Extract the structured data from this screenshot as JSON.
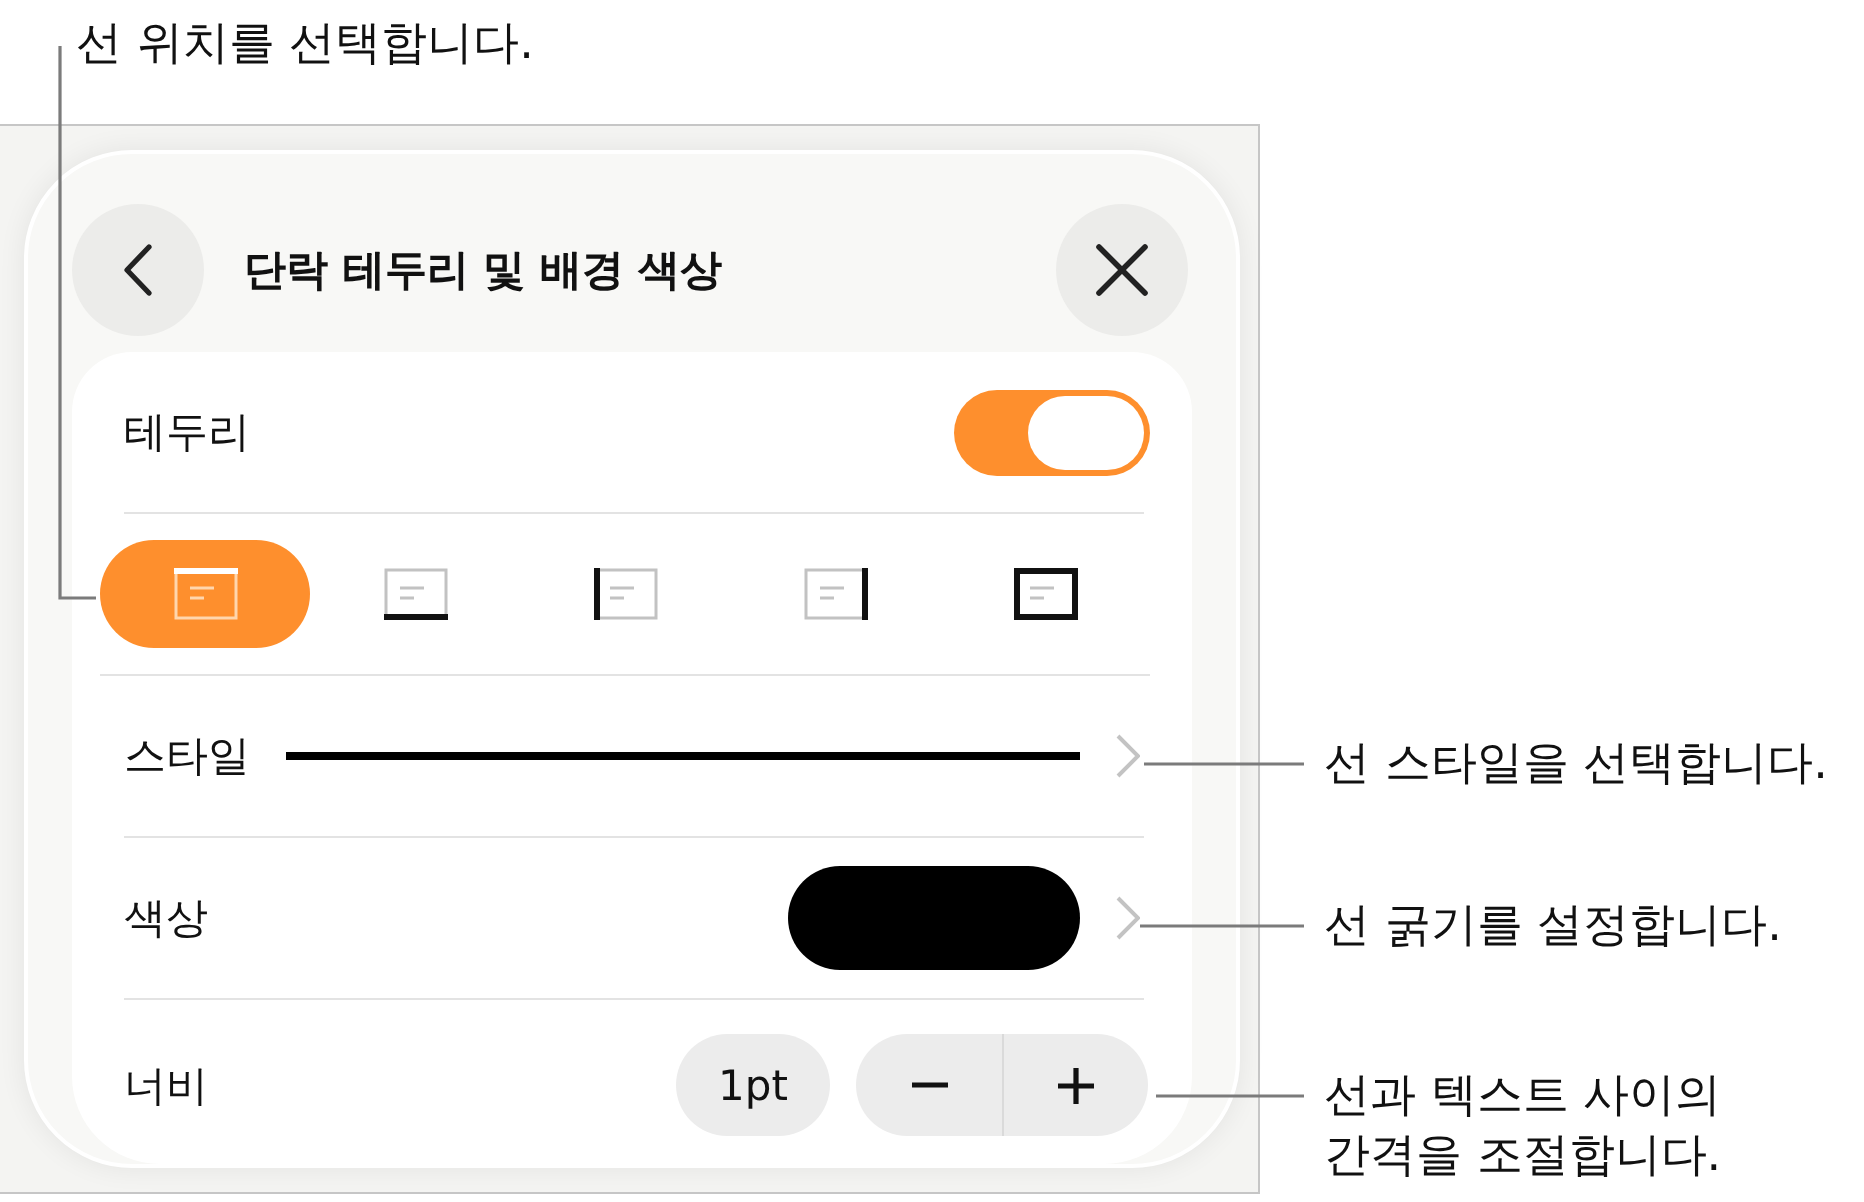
{
  "position_callout": {
    "text": "선 위치를 선택합니다."
  },
  "panel": {
    "title": "단락 테두리 및 배경 색상",
    "rows": [
      {
        "kind": "toggle",
        "label": "테두리",
        "on": true
      },
      {
        "kind": "border_positions",
        "options": [
          {
            "kind": "top",
            "selected": true
          },
          {
            "kind": "bottom",
            "selected": false
          },
          {
            "kind": "left",
            "selected": false
          },
          {
            "kind": "right",
            "selected": false
          },
          {
            "kind": "box",
            "selected": false
          }
        ]
      },
      {
        "kind": "line_style",
        "label": "스타일",
        "dashed": false
      },
      {
        "kind": "color",
        "label": "색상",
        "color": "#000000"
      },
      {
        "kind": "stepper",
        "label": "너비",
        "value": "1pt"
      }
    ]
  },
  "side_callouts": [
    {
      "text": "선 스타일을 선택합니다."
    },
    {
      "text": "선 굵기를 설정합니다."
    },
    {
      "text": "선과 텍스트 사이의\n간격을 조절합니다."
    }
  ]
}
